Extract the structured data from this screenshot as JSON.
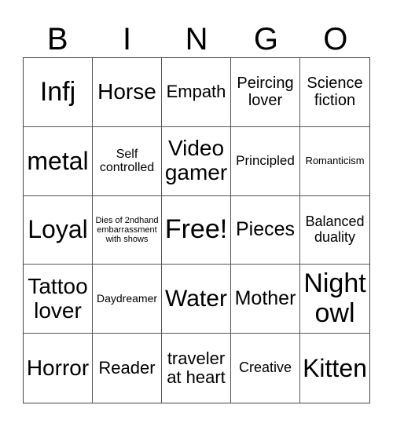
{
  "title_letters": [
    "B",
    "I",
    "N",
    "G",
    "O"
  ],
  "cells": [
    {
      "text": "Infj",
      "size": 34
    },
    {
      "text": "Horse",
      "size": 28
    },
    {
      "text": "Empath",
      "size": 22
    },
    {
      "text": "Peircing lover",
      "size": 20
    },
    {
      "text": "Science fiction",
      "size": 20
    },
    {
      "text": "metal",
      "size": 32
    },
    {
      "text": "Self controlled",
      "size": 16
    },
    {
      "text": "Video gamer",
      "size": 28
    },
    {
      "text": "Principled",
      "size": 17
    },
    {
      "text": "Romanticism",
      "size": 13
    },
    {
      "text": "Loyal",
      "size": 32
    },
    {
      "text": "Dies of 2ndhand embarrassment with shows",
      "size": 11
    },
    {
      "text": "Free!",
      "size": 34
    },
    {
      "text": "Pieces",
      "size": 25
    },
    {
      "text": "Balanced duality",
      "size": 18
    },
    {
      "text": "Tattoo lover",
      "size": 28
    },
    {
      "text": "Daydreamer",
      "size": 14
    },
    {
      "text": "Water",
      "size": 30
    },
    {
      "text": "Mother",
      "size": 25
    },
    {
      "text": "Night owl",
      "size": 34
    },
    {
      "text": "Horror",
      "size": 28
    },
    {
      "text": "Reader",
      "size": 22
    },
    {
      "text": "traveler at heart",
      "size": 22
    },
    {
      "text": "Creative",
      "size": 18
    },
    {
      "text": "Kitten",
      "size": 32
    }
  ]
}
